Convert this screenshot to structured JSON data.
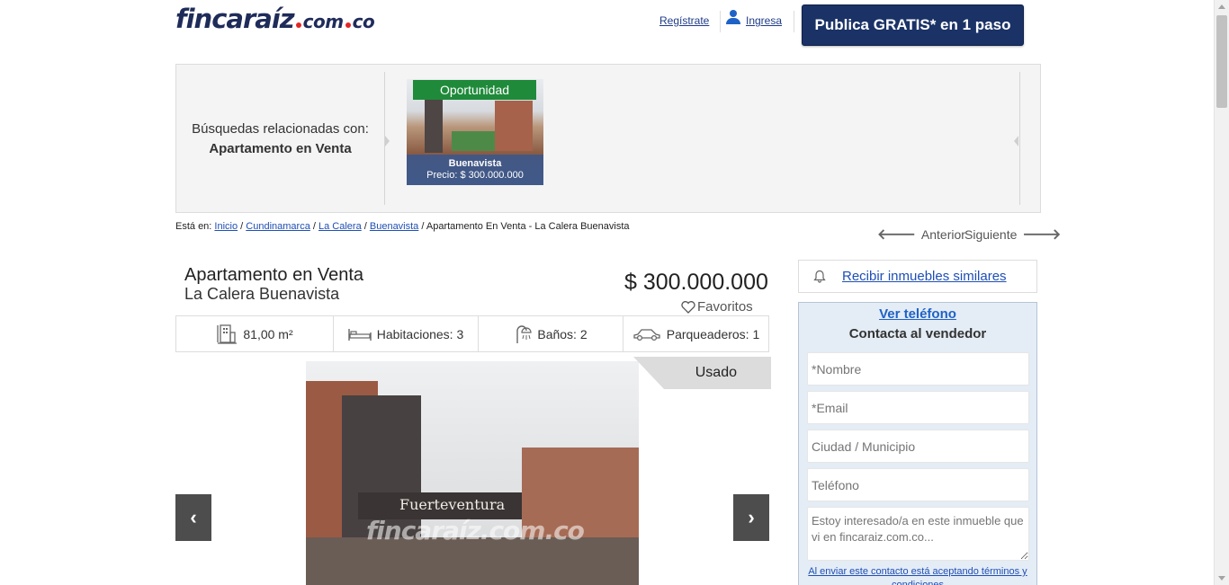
{
  "header": {
    "logo_main": "fincaraíz",
    "logo_sub": "com",
    "logo_tld": "co",
    "register_label": "Regístrate",
    "login_label": "Ingresa",
    "publish_label": "Publica GRATIS* en 1 paso"
  },
  "related": {
    "prefix": "Búsquedas relacionadas con:",
    "query": "Apartamento en Venta",
    "card": {
      "badge": "Oportunidad",
      "title": "Buenavista",
      "price": "Precio: $ 300.000.000"
    }
  },
  "breadcrumb": {
    "prefix": "Está en:",
    "items": [
      "Inicio",
      "Cundinamarca",
      "La Calera",
      "Buenavista"
    ],
    "current": "Apartamento En Venta - La Calera Buenavista"
  },
  "nav": {
    "prev": "Anterior",
    "next": "Siguiente"
  },
  "listing": {
    "title": "Apartamento en Venta",
    "subtitle": "La Calera Buenavista",
    "price": "$ 300.000.000",
    "favorites": "Favoritos",
    "features": {
      "area": "81,00 m²",
      "rooms": "Habitaciones: 3",
      "baths": "Baños: 2",
      "parking": "Parqueaderos: 1"
    },
    "status_badge": "Usado",
    "photo_sign": "Fuerteventura",
    "photo_watermark": "fincaraíz.com.co"
  },
  "sidebar": {
    "alert_label": "Recibir inmuebles similares",
    "phone_link": "Ver teléfono",
    "contact_heading": "Contacta al vendedor",
    "fields": {
      "name": "*Nombre",
      "email": "*Email",
      "city": "Ciudad / Municipio",
      "phone": "Teléfono",
      "message": "Estoy interesado/a en este inmueble que vi en fincaraiz.com.co..."
    },
    "terms": "Al enviar este contacto está aceptando términos y condiciones"
  },
  "colors": {
    "brand_navy": "#1a3266",
    "logo_red": "#e42526",
    "link_blue": "#1f4fb5",
    "badge_green": "#1f8a3a"
  }
}
